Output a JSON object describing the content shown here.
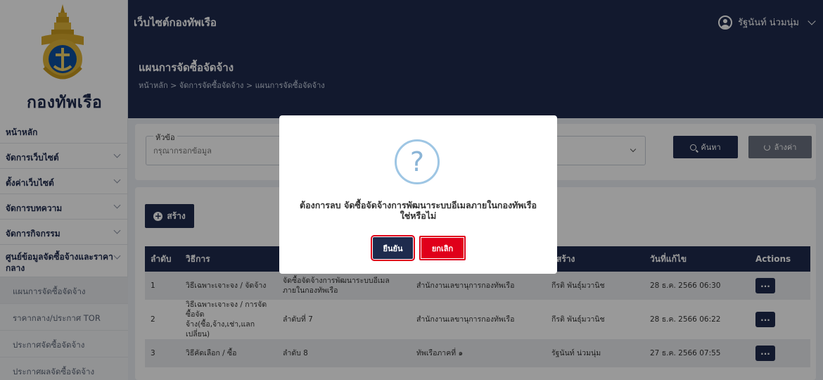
{
  "sidebar": {
    "logo_text": "กองทัพเรือ",
    "items": [
      {
        "label": "หน้าหลัก",
        "has_chevron": false
      },
      {
        "label": "จัดการเว็บไซต์",
        "has_chevron": true
      },
      {
        "label": "ตั้งค่าเว็บไซต์",
        "has_chevron": true
      },
      {
        "label": "จัดการบทความ",
        "has_chevron": true
      },
      {
        "label": "จัดการกิจกรรม",
        "has_chevron": true
      }
    ],
    "procurement_group": {
      "label": "ศูนย์ข้อมูลจัดซื้อจ้างและราคากลาง",
      "sub_items": [
        {
          "label": "แผนการจัดซื้อจัดจ้าง",
          "active": true
        },
        {
          "label": "ราคากลาง/ประกาศ TOR",
          "active": false
        },
        {
          "label": "ประกาศจัดซื้อจัดจ้าง",
          "active": false
        },
        {
          "label": "ประกาศผลจัดซื้อจัดจ้าง",
          "active": false
        }
      ]
    }
  },
  "topbar": {
    "site_title": "เว็บไซต์กองทัพเรือ",
    "user_name": "รัฐนันท์ น่วมนุ่ม"
  },
  "page": {
    "title": "แผนการจัดซื้อจัดจ้าง",
    "breadcrumb": "หน้าหลัก > จัดการจัดซื้อจัดจ้าง > แผนการจัดซื้อจัดจ้าง"
  },
  "filter": {
    "topic_label": "หัวข้อ",
    "topic_placeholder": "กรุณากรอกข้อมูล",
    "search_label": "ค้นหา",
    "clear_label": "ล้างค่า"
  },
  "table": {
    "create_label": "สร้าง",
    "headers": [
      "ลำดับ",
      "วิธีการ",
      "",
      "",
      "ผู้สร้าง",
      "วันที่แก้ไข",
      "Actions"
    ],
    "rows": [
      {
        "no": "1",
        "method": "วิธีเฉพาะเจาะจง / จัดจ้าง",
        "name": "จัดซื้อจัดจ้างการพัฒนาระบบอีเมลภายในกองทัพเรือ",
        "unit": "สำนักงานเลขานุการกองทัพเรือ",
        "creator": "กีรติ พันธุ์มวานิช",
        "modified": "28 ธ.ค. 2566 06:30",
        "action": "..."
      },
      {
        "no": "2",
        "method": "วิธีเฉพาะเจาะจง / การจัดซื้อจัดจ้าง(ซื้อ,จ้าง,เช่า,แลกเปลี่ยน)",
        "name": "ลำดับที่ 7",
        "unit": "สำนักงานเลขานุการกองทัพเรือ",
        "creator": "กีรติ พันธุ์มวานิช",
        "modified": "28 ธ.ค. 2566 06:22",
        "action": "..."
      },
      {
        "no": "3",
        "method": "วิธีคัดเลือก / ซื้อ",
        "name": "ลำดับ 8",
        "unit": "ทัพเรือภาคที่ ๑",
        "creator": "รัฐนันท์ น่วมนุ่ม",
        "modified": "27 ธ.ค. 2566 07:55",
        "action": "..."
      }
    ]
  },
  "modal": {
    "icon_char": "?",
    "message": "ต้องการลบ จัดซื้อจัดจ้างการพัฒนาระบบอีเมลภายในกองทัพเรือ ใช่หรือไม่",
    "confirm_label": "ยืนยัน",
    "cancel_label": "ยกเลิก"
  },
  "colors": {
    "navy": "#1e2b4d",
    "danger": "#e0001a",
    "icon_blue": "#9ec6e4"
  }
}
